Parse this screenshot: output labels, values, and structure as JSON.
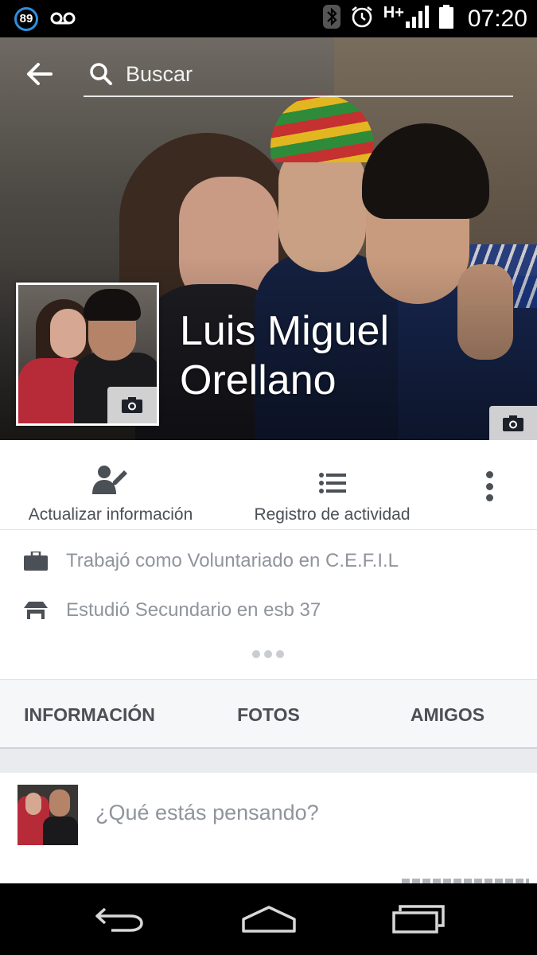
{
  "status_bar": {
    "notification_count": "89",
    "network": "H+",
    "time": "07:20"
  },
  "search": {
    "placeholder": "Buscar"
  },
  "profile": {
    "name": "Luis Miguel Orellano"
  },
  "actions": {
    "update_label": "Actualizar información",
    "activity_label": "Registro de actividad"
  },
  "intro": {
    "work": "Trabajó como Voluntariado en C.E.F.I.L",
    "education": "Estudió Secundario en esb 37"
  },
  "tabs": [
    {
      "label": "INFORMACIÓN"
    },
    {
      "label": "FOTOS"
    },
    {
      "label": "AMIGOS"
    }
  ],
  "composer": {
    "prompt": "¿Qué estás pensando?"
  },
  "colors": {
    "text_dark": "#4b4f56",
    "text_muted": "#90949c",
    "badge_blue": "#2f8fe0",
    "tab_bg": "#f6f7f9"
  }
}
